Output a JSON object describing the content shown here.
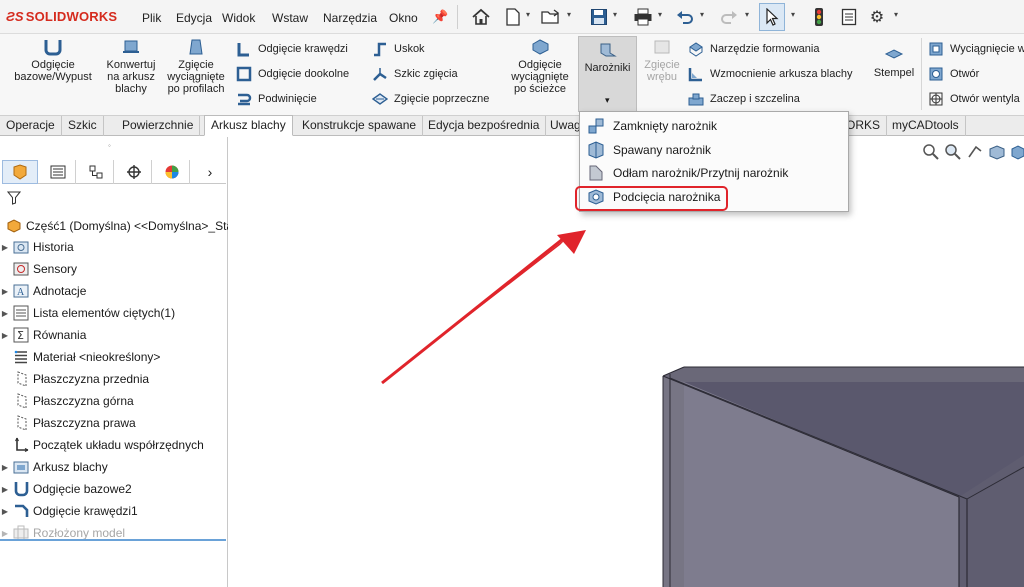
{
  "app": {
    "logo": "SOLIDWORKS"
  },
  "menu": [
    "Plik",
    "Edycja",
    "Widok",
    "Wstaw",
    "Narzędzia",
    "Okno"
  ],
  "ribbon": {
    "odgiecie_bazowe": "Odgięcie bazowe/Wypust",
    "konwertuj": "Konwertuj na arkusz blachy",
    "zgiecie_wyciagniete": "Zgięcie wyciągnięte po profilach",
    "odgiecie_krawedzi": "Odgięcie krawędzi",
    "odgiecie_dookolne": "Odgięcie dookolne",
    "podwiniecie": "Podwinięcie",
    "uskok": "Uskok",
    "szkic_zgiecia": "Szkic zgięcia",
    "zgiecie_poprzeczne": "Zgięcie poprzeczne",
    "odgiecie_sciezce": "Odgięcie wyciągnięte po ścieżce",
    "narozniki": "Narożniki",
    "zgiecie_wrebu": "Zgięcie wrębu",
    "narzedzie_formowania": "Narzędzie formowania",
    "wzmocnienie": "Wzmocnienie arkusza blachy",
    "zaczep": "Zaczep i szczelina",
    "stempel": "Stempel",
    "wyciagniecie": "Wyciągnięcie w",
    "otwor": "Otwór",
    "otwor_wentyl": "Otwór wentyla"
  },
  "tabs": [
    "Operacje",
    "Szkic",
    "Powierzchnie",
    "Arkusz blachy",
    "Konstrukcje spawane",
    "Edycja bezpośrednia",
    "Uwag",
    "ORKS",
    "myCADtools"
  ],
  "active_tab": "Arkusz blachy",
  "dropdown": {
    "items": [
      "Zamknięty narożnik",
      "Spawany narożnik",
      "Odłam narożnik/Przytnij narożnik",
      "Podcięcia narożnika"
    ],
    "highlighted": "Podcięcia narożnika",
    "highlight_color": "#e0242b"
  },
  "tree": {
    "root": "Część1 (Domyślna) <<Domyślna>_Sta",
    "items": [
      "Historia",
      "Sensory",
      "Adnotacje",
      "Lista elementów ciętych(1)",
      "Równania",
      "Materiał <nieokreślony>",
      "Płaszczyzna przednia",
      "Płaszczyzna górna",
      "Płaszczyzna prawa",
      "Początek układu współrzędnych",
      "Arkusz blachy",
      "Odgięcie bazowe2",
      "Odgięcie krawędzi1",
      "Rozłożony model"
    ]
  },
  "colors": {
    "annotation_arrow": "#e0242b",
    "brand": "#d52b1e"
  }
}
